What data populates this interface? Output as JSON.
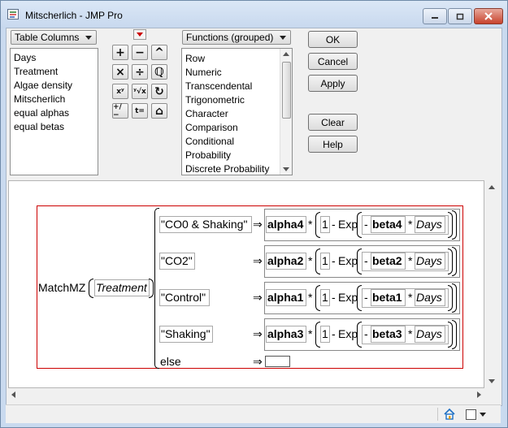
{
  "window": {
    "title": "Mitscherlich - JMP Pro"
  },
  "left_panel": {
    "dropdown_label": "Table Columns",
    "columns": [
      "Days",
      "Treatment",
      "Algae density",
      "Mitscherlich",
      "equal alphas",
      "equal betas"
    ]
  },
  "functions_panel": {
    "dropdown_label": "Functions (grouped)",
    "items": [
      "Row",
      "Numeric",
      "Transcendental",
      "Trigonometric",
      "Character",
      "Comparison",
      "Conditional",
      "Probability",
      "Discrete Probability"
    ]
  },
  "keypad": {
    "keys": [
      "+",
      "−",
      "^",
      "×",
      "÷",
      "ℚ",
      "xʸ",
      "ʸ√x",
      "↻",
      "+/−",
      "t=",
      "⌂"
    ]
  },
  "buttons": {
    "ok": "OK",
    "cancel": "Cancel",
    "apply": "Apply",
    "clear": "Clear",
    "help": "Help"
  },
  "formula": {
    "function_name": "MatchMZ",
    "argument": "Treatment",
    "arrow": "⇒",
    "times": "*",
    "minus": "-",
    "one": "1",
    "exp": "Exp",
    "variable": "Days",
    "else_label": "else",
    "cases": [
      {
        "match": "\"CO0 & Shaking\"",
        "alpha": "alpha4",
        "beta": "beta4"
      },
      {
        "match": "\"CO2\"",
        "alpha": "alpha2",
        "beta": "beta2"
      },
      {
        "match": "\"Control\"",
        "alpha": "alpha1",
        "beta": "beta1"
      },
      {
        "match": "\"Shaking\"",
        "alpha": "alpha3",
        "beta": "beta3"
      }
    ]
  }
}
